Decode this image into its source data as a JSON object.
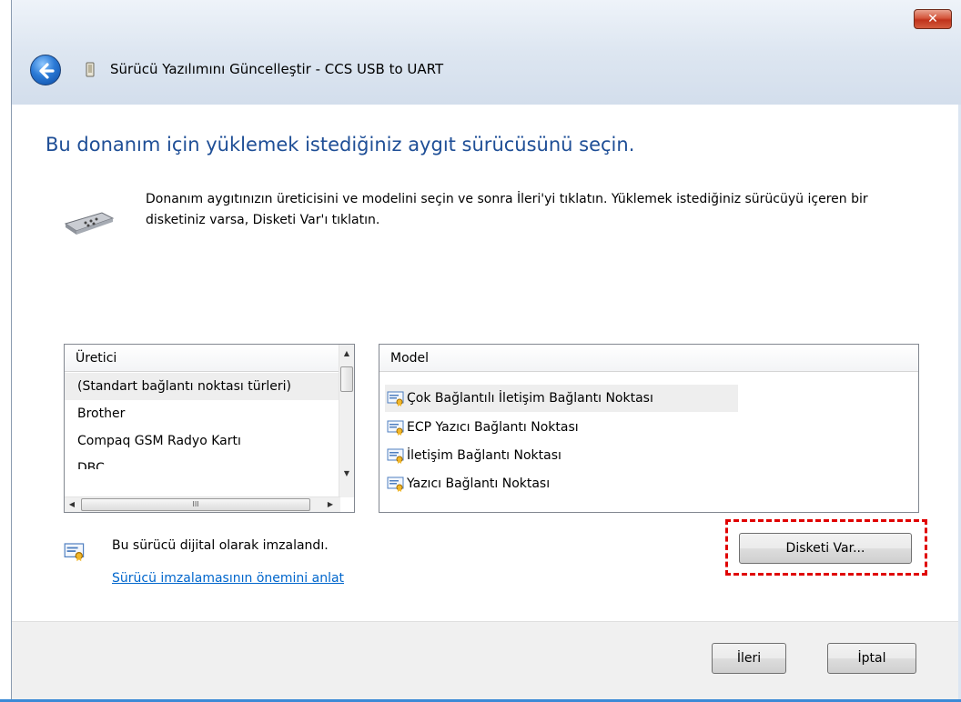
{
  "window": {
    "title": "Sürücü Yazılımını Güncelleştir - CCS USB to UART",
    "close_label": "✕"
  },
  "page": {
    "heading": "Bu donanım için yüklemek istediğiniz aygıt sürücüsünü seçin.",
    "description": "Donanım aygıtınızın üreticisini ve modelini seçin ve sonra İleri'yi tıklatın. Yüklemek istediğiniz sürücüyü içeren bir disketiniz varsa, Disketi Var'ı tıklatın."
  },
  "manufacturer_list": {
    "header": "Üretici",
    "items": [
      "(Standart bağlantı noktası türleri)",
      "Brother",
      "Compaq GSM Radyo Kartı",
      "DBC"
    ],
    "selected_index": 0,
    "hscroll_grip": "III"
  },
  "model_list": {
    "header": "Model",
    "items": [
      "Çok Bağlantılı İletişim Bağlantı Noktası",
      "ECP Yazıcı Bağlantı Noktası",
      "İletişim Bağlantı Noktası",
      "Yazıcı Bağlantı Noktası"
    ],
    "selected_index": 0
  },
  "signature": {
    "text": "Bu sürücü dijital olarak imzalandı.",
    "link": "Sürücü imzalamasının önemini anlat"
  },
  "buttons": {
    "have_disk": "Disketi Var...",
    "next": "İleri",
    "cancel": "İptal"
  },
  "colors": {
    "heading": "#1e4e96",
    "link": "#0066cc",
    "highlight": "#e00000"
  }
}
